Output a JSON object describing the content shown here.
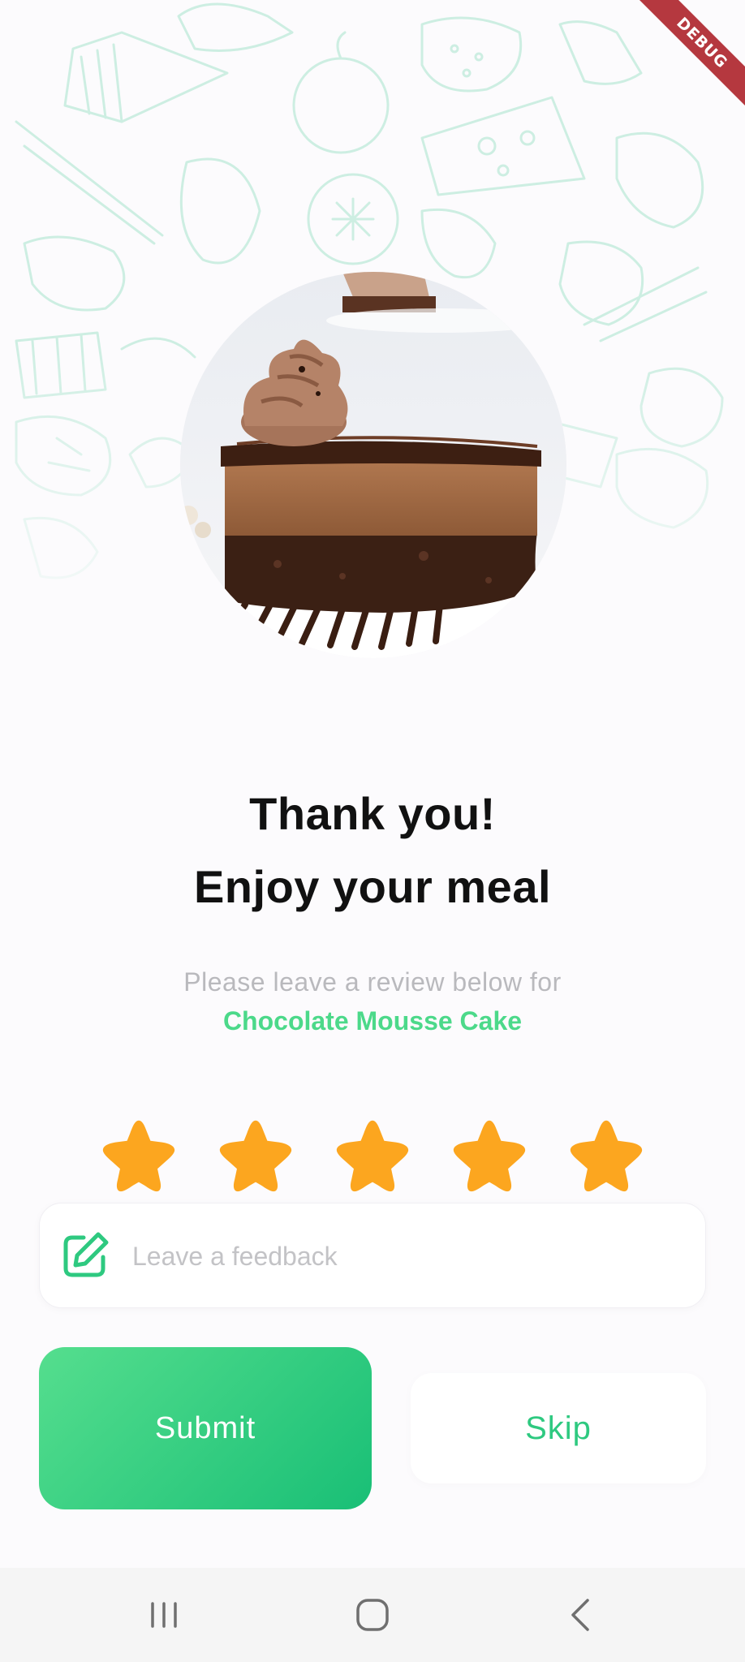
{
  "debug_banner": "DEBUG",
  "heading": {
    "line1": "Thank you!",
    "line2": "Enjoy your meal"
  },
  "review_prompt": "Please leave a review below for",
  "dish_name": "Chocolate Mousse Cake",
  "rating": {
    "value": 5,
    "max": 5
  },
  "feedback": {
    "placeholder": "Leave a feedback",
    "value": ""
  },
  "actions": {
    "submit_label": "Submit",
    "skip_label": "Skip"
  },
  "colors": {
    "accent": "#4cd98a",
    "star": "#fca61f",
    "submit_gradient_start": "#55de8e",
    "submit_gradient_end": "#19bf76",
    "debug_ribbon": "#b5383f"
  },
  "icons": {
    "feedback": "edit-note-icon",
    "nav_recent": "recent-apps-icon",
    "nav_home": "home-icon",
    "nav_back": "back-icon"
  }
}
